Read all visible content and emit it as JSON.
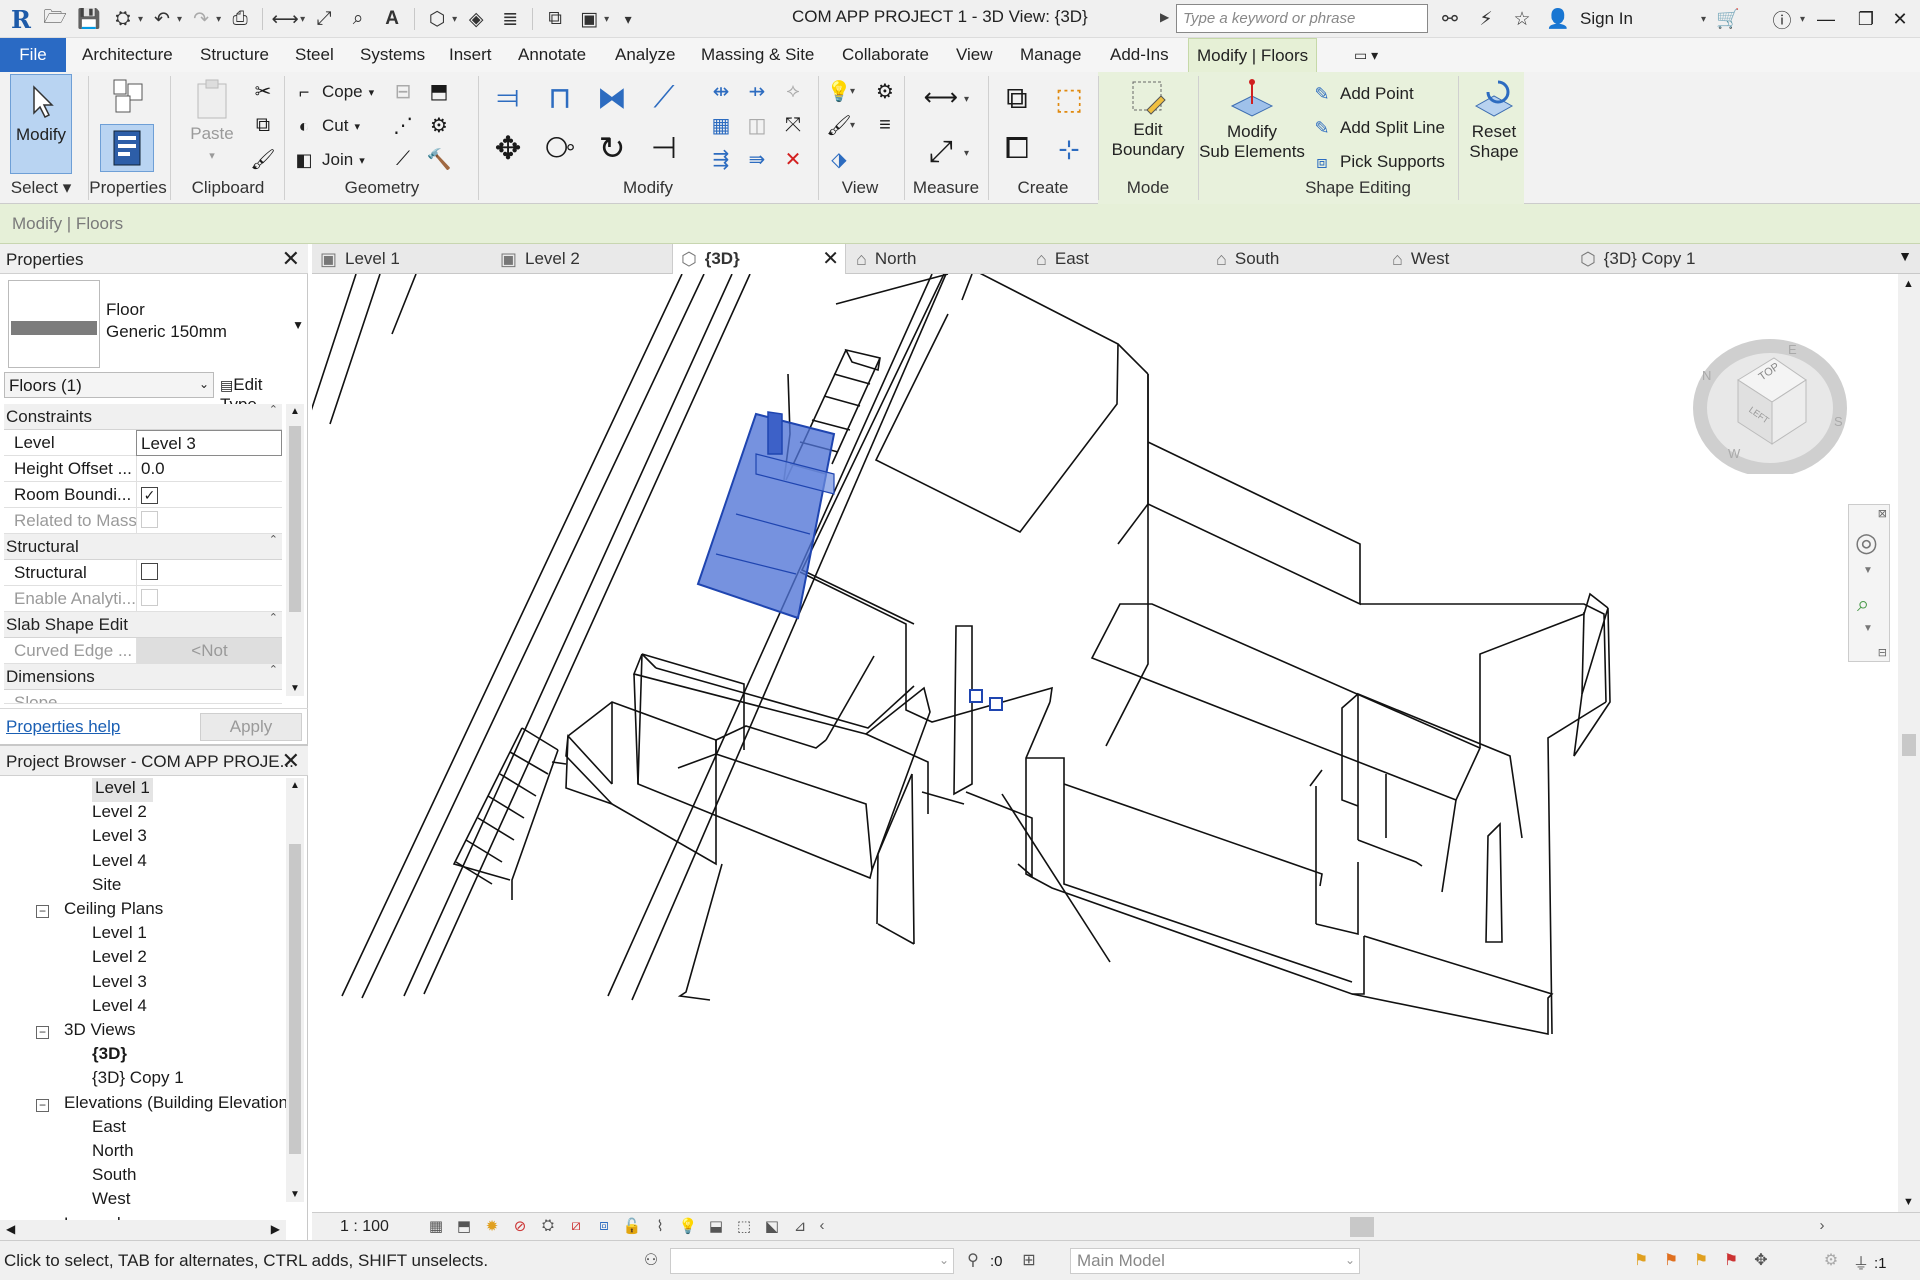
{
  "window": {
    "title": "COM APP PROJECT 1 - 3D View: {3D}",
    "search_placeholder": "Type a keyword or phrase",
    "sign_in": "Sign In",
    "app_logo": "R"
  },
  "ribbon_tabs": [
    "File",
    "Architecture",
    "Structure",
    "Steel",
    "Systems",
    "Insert",
    "Annotate",
    "Analyze",
    "Massing & Site",
    "Collaborate",
    "View",
    "Manage",
    "Add-Ins",
    "Modify | Floors"
  ],
  "ribbon": {
    "select": {
      "modify": "Modify",
      "label": "Select"
    },
    "properties": {
      "label": "Properties"
    },
    "clipboard": {
      "paste": "Paste",
      "label": "Clipboard"
    },
    "geometry": {
      "cope": "Cope",
      "cut": "Cut",
      "join": "Join",
      "label": "Geometry"
    },
    "modify": {
      "label": "Modify"
    },
    "view": {
      "label": "View"
    },
    "measure": {
      "label": "Measure"
    },
    "create": {
      "label": "Create"
    },
    "mode": {
      "edit": "Edit",
      "boundary": "Boundary",
      "label": "Mode"
    },
    "shape_editing": {
      "modify": "Modify",
      "sub_elements": "Sub Elements",
      "add_point": "Add Point",
      "add_split_line": "Add Split Line",
      "pick_supports": "Pick Supports",
      "reset": "Reset",
      "shape": "Shape",
      "label": "Shape Editing"
    }
  },
  "options_bar": {
    "context": "Modify | Floors"
  },
  "properties": {
    "title": "Properties",
    "type_family": "Floor",
    "type_name": "Generic 150mm",
    "instance_filter": "Floors (1)",
    "edit_type": "Edit Type",
    "rows": {
      "constraints": "Constraints",
      "level_key": "Level",
      "level_val": "Level 3",
      "height_key": "Height Offset ...",
      "height_val": "0.0",
      "room_key": "Room Boundi...",
      "related_key": "Related to Mass",
      "structural_group": "Structural",
      "structural_key": "Structural",
      "analytic_key": "Enable Analyti...",
      "slab_group": "Slab Shape Edit",
      "curved_key": "Curved Edge ...",
      "curved_val": "<Not",
      "dimensions_group": "Dimensions",
      "slope_key": "Slope"
    },
    "help": "Properties help",
    "apply": "Apply"
  },
  "browser": {
    "title": "Project Browser - COM APP PROJE...",
    "items": [
      {
        "label": "Level 1",
        "level": 2,
        "selected": true
      },
      {
        "label": "Level 2",
        "level": 2
      },
      {
        "label": "Level 3",
        "level": 2
      },
      {
        "label": "Level 4",
        "level": 2
      },
      {
        "label": "Site",
        "level": 2
      },
      {
        "label": "Ceiling Plans",
        "level": 1,
        "toggle": "−"
      },
      {
        "label": "Level 1",
        "level": 2
      },
      {
        "label": "Level 2",
        "level": 2
      },
      {
        "label": "Level 3",
        "level": 2
      },
      {
        "label": "Level 4",
        "level": 2
      },
      {
        "label": "3D Views",
        "level": 1,
        "toggle": "−"
      },
      {
        "label": "{3D}",
        "level": 2,
        "bold": true
      },
      {
        "label": "{3D} Copy 1",
        "level": 2
      },
      {
        "label": "Elevations (Building Elevation",
        "level": 1,
        "toggle": "−"
      },
      {
        "label": "East",
        "level": 2
      },
      {
        "label": "North",
        "level": 2
      },
      {
        "label": "South",
        "level": 2
      },
      {
        "label": "West",
        "level": 2
      },
      {
        "label": "Legends",
        "level": 1,
        "toggle": "+"
      }
    ]
  },
  "view_tabs": [
    {
      "label": "Level 1",
      "icon": "floor-plan-icon"
    },
    {
      "label": "Level 2",
      "icon": "floor-plan-icon"
    },
    {
      "label": "{3D}",
      "icon": "3d-view-icon",
      "active": true
    },
    {
      "label": "North",
      "icon": "elevation-icon"
    },
    {
      "label": "East",
      "icon": "elevation-icon"
    },
    {
      "label": "South",
      "icon": "elevation-icon"
    },
    {
      "label": "West",
      "icon": "elevation-icon"
    },
    {
      "label": "{3D} Copy 1",
      "icon": "3d-view-icon"
    }
  ],
  "viewcube": {
    "top": "TOP",
    "left": "LEFT",
    "n": "N",
    "e": "E",
    "s": "S",
    "w": "W"
  },
  "view_control": {
    "scale": "1 : 100"
  },
  "status": {
    "text": "Click to select, TAB for alternates, CTRL adds, SHIFT unselects.",
    "worksets_count": ":0",
    "model": "Main Model",
    "filter_count": ":1"
  },
  "colors": {
    "file_tab": "#2a6ac4",
    "context_tab": "#e6f0d6",
    "selection": "#4f73d6"
  }
}
